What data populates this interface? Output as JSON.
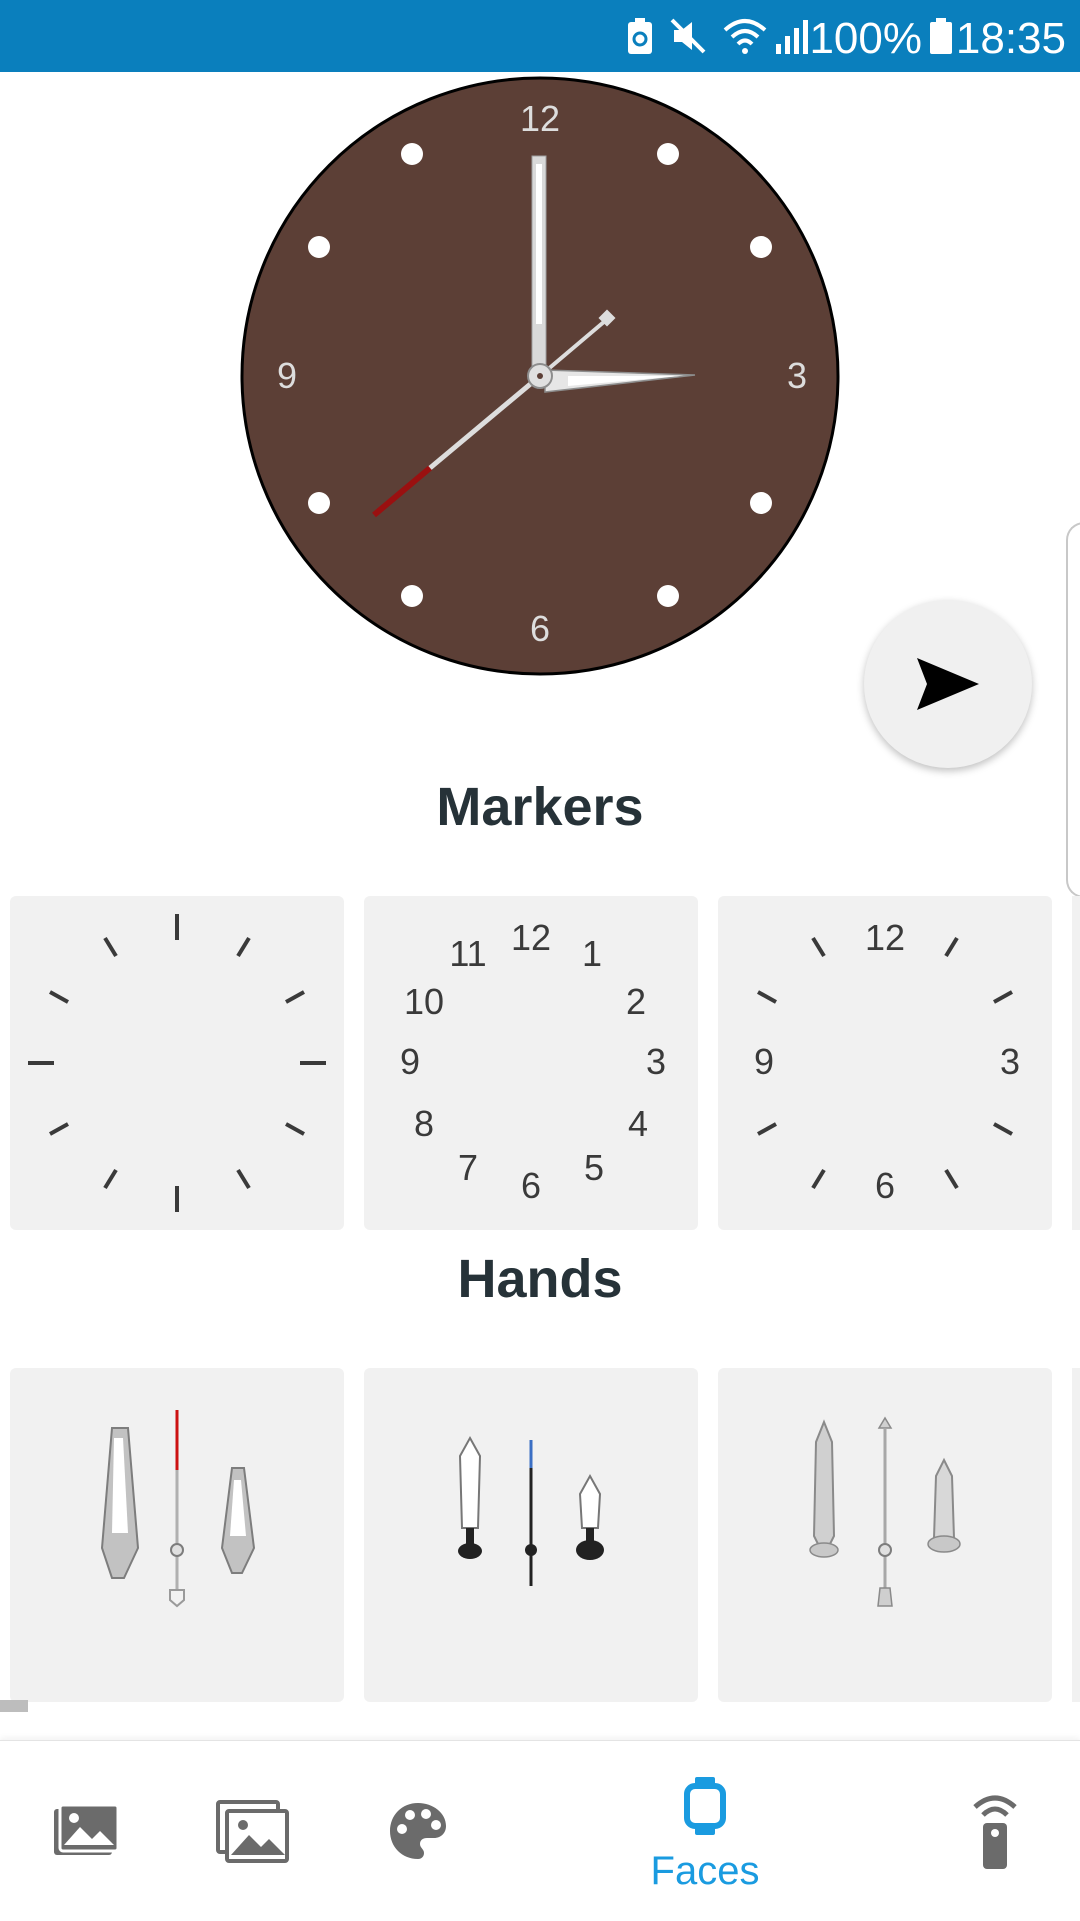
{
  "status_bar": {
    "battery_text": "100%",
    "time": "18:35",
    "icons": [
      "battery-saver-icon",
      "mute-icon",
      "wifi-icon",
      "signal-icon",
      "battery-icon"
    ],
    "bg_color": "#0a7fbd"
  },
  "preview": {
    "dial_color": "#5c3f36",
    "numerals": {
      "twelve": "12",
      "three": "3",
      "six": "6",
      "nine": "9"
    },
    "send_icon": "send-icon"
  },
  "sections": {
    "markers_title": "Markers",
    "hands_title": "Hands"
  },
  "markers": [
    {
      "name": "tick-marks"
    },
    {
      "name": "all-numerals",
      "numerals": [
        "12",
        "1",
        "2",
        "3",
        "4",
        "5",
        "6",
        "7",
        "8",
        "9",
        "10",
        "11"
      ]
    },
    {
      "name": "quarter-numerals",
      "numerals": {
        "twelve": "12",
        "three": "3",
        "six": "6",
        "nine": "9"
      }
    }
  ],
  "hands": [
    {
      "name": "silver-dauphine-hands"
    },
    {
      "name": "black-sword-hands"
    },
    {
      "name": "silver-baton-hands"
    }
  ],
  "bottom_nav": {
    "items": [
      {
        "icon": "photo-icon"
      },
      {
        "icon": "gallery-icon"
      },
      {
        "icon": "palette-icon"
      },
      {
        "icon": "watch-icon",
        "label": "Faces",
        "active": true
      },
      {
        "icon": "remote-icon"
      }
    ],
    "active_color": "#1a9be0"
  }
}
